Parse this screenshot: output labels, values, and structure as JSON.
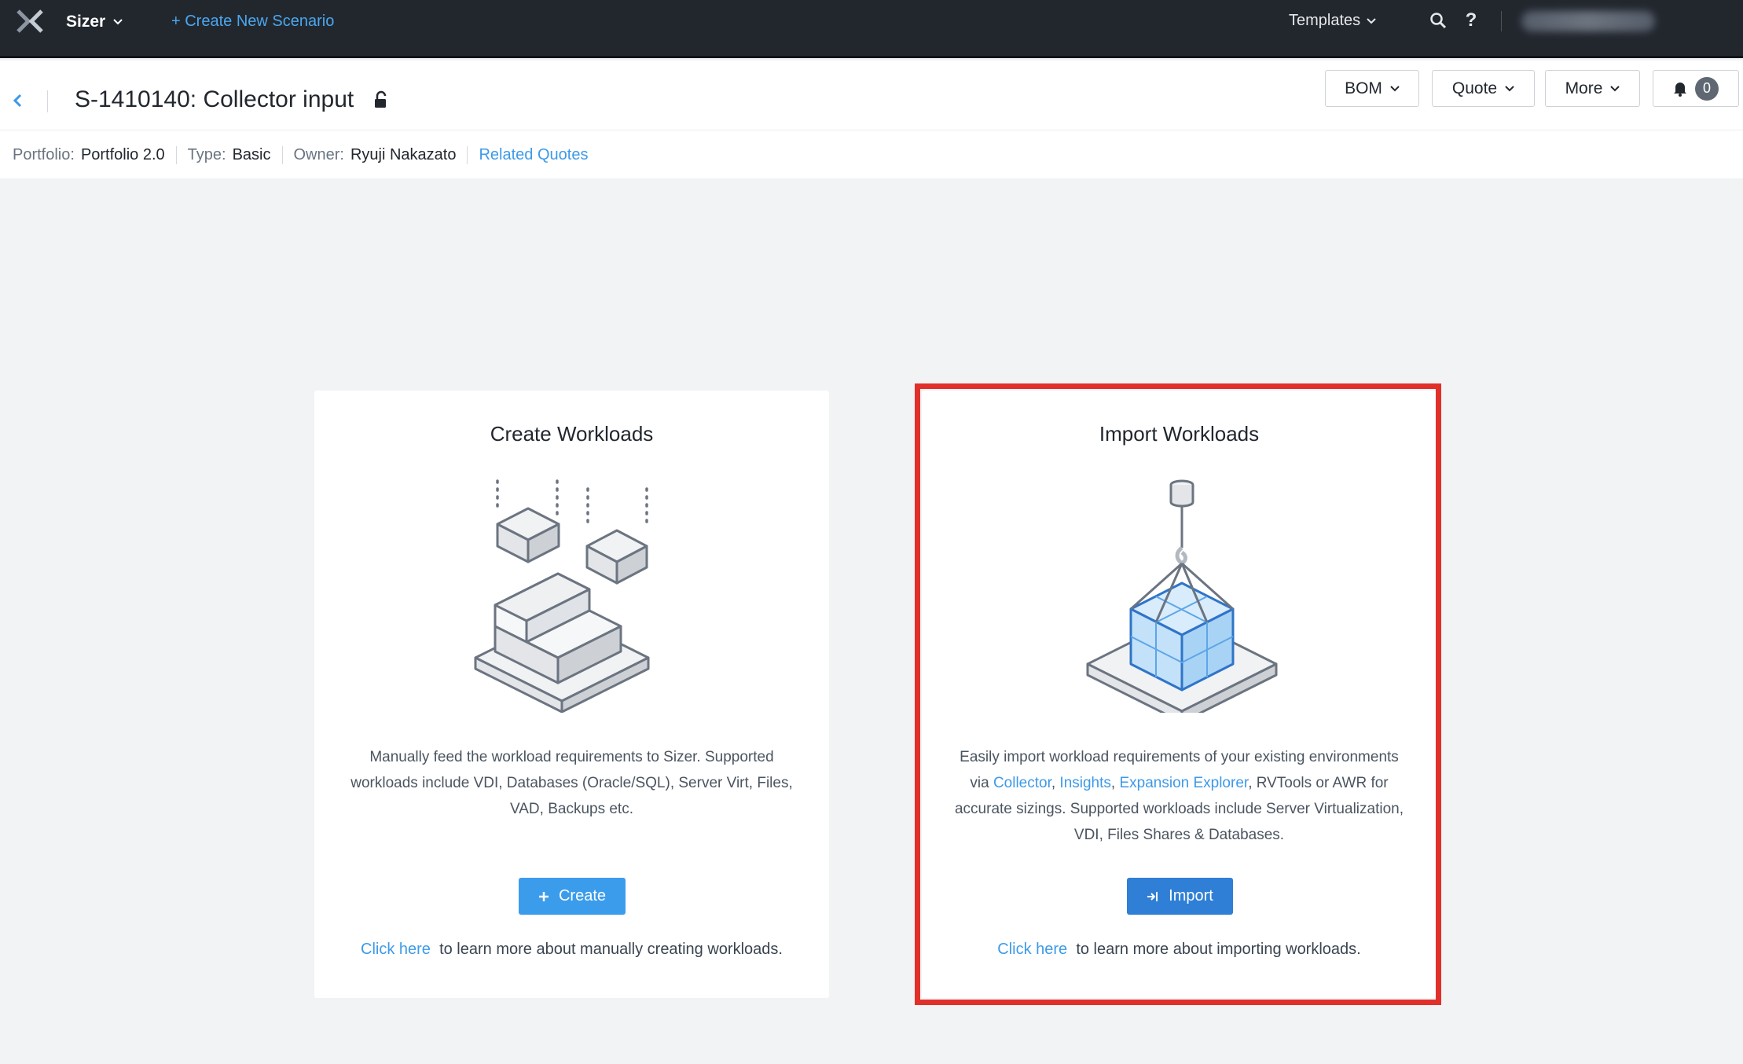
{
  "topnav": {
    "app_name": "Sizer",
    "create_scenario": "+ Create New Scenario",
    "templates": "Templates",
    "search_icon": "search-icon",
    "help_icon": "?"
  },
  "header": {
    "title": "S-1410140: Collector input",
    "buttons": {
      "bom": "BOM",
      "quote": "Quote",
      "more": "More",
      "notifications_count": "0"
    },
    "meta": {
      "portfolio_label": "Portfolio:",
      "portfolio_value": "Portfolio 2.0",
      "type_label": "Type:",
      "type_value": "Basic",
      "owner_label": "Owner:",
      "owner_value": "Ryuji Nakazato",
      "related_quotes": "Related Quotes"
    }
  },
  "cards": {
    "create": {
      "title": "Create Workloads",
      "description": "Manually feed the workload requirements to Sizer. Supported workloads include VDI, Databases (Oracle/SQL), Server Virt, Files, VAD, Backups etc.",
      "button": "Create",
      "learn_link": "Click here",
      "learn_text": "to learn more about manually creating workloads."
    },
    "import": {
      "title": "Import Workloads",
      "desc_1": "Easily import workload requirements of your existing environments via",
      "link_collector": "Collector",
      "link_insights": "Insights",
      "link_expansion": "Expansion Explorer",
      "desc_2": "RVTools or AWR for accurate sizings. Supported workloads include Server Virtualization, VDI, Files Shares & Databases.",
      "button": "Import",
      "learn_link": "Click here",
      "learn_text": "to learn more about importing workloads."
    }
  },
  "colors": {
    "nav_bg": "#22272e",
    "link": "#3d9ae8",
    "create_button": "#3b9cec",
    "import_button": "#2f7fd6",
    "highlight": "#e1302a"
  }
}
